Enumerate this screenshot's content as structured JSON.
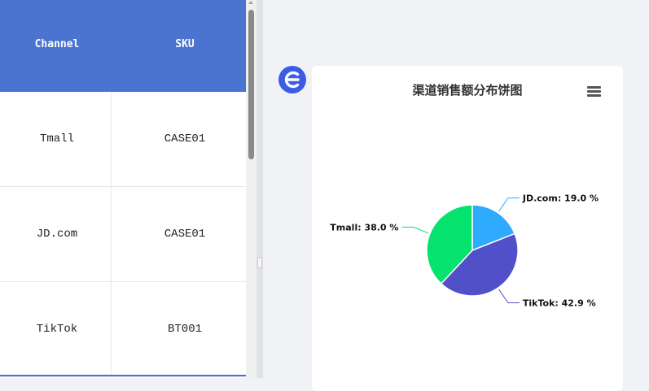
{
  "table": {
    "columns": [
      "Channel",
      "SKU"
    ],
    "rows": [
      {
        "channel": "Tmall",
        "sku": "CASE01"
      },
      {
        "channel": "JD.com",
        "sku": "CASE01"
      },
      {
        "channel": "TikTok",
        "sku": "BT001"
      }
    ]
  },
  "chart_data": {
    "type": "pie",
    "title": "渠道销售额分布饼图",
    "slices": [
      {
        "name": "JD.com",
        "percent": 19.0,
        "label": "JD.com: 19.0 %",
        "color": "#2eaaff"
      },
      {
        "name": "TikTok",
        "percent": 42.9,
        "label": "TikTok: 42.9 %",
        "color": "#5250c9"
      },
      {
        "name": "Tmall",
        "percent": 38.0,
        "label": "Tmall: 38.0 %",
        "color": "#05e36e"
      }
    ]
  },
  "colors": {
    "header": "#4a74cf",
    "logo": "#3d5ce6"
  },
  "icons": {
    "logo": "echarts-logo-icon",
    "menu": "hamburger-menu-icon"
  }
}
